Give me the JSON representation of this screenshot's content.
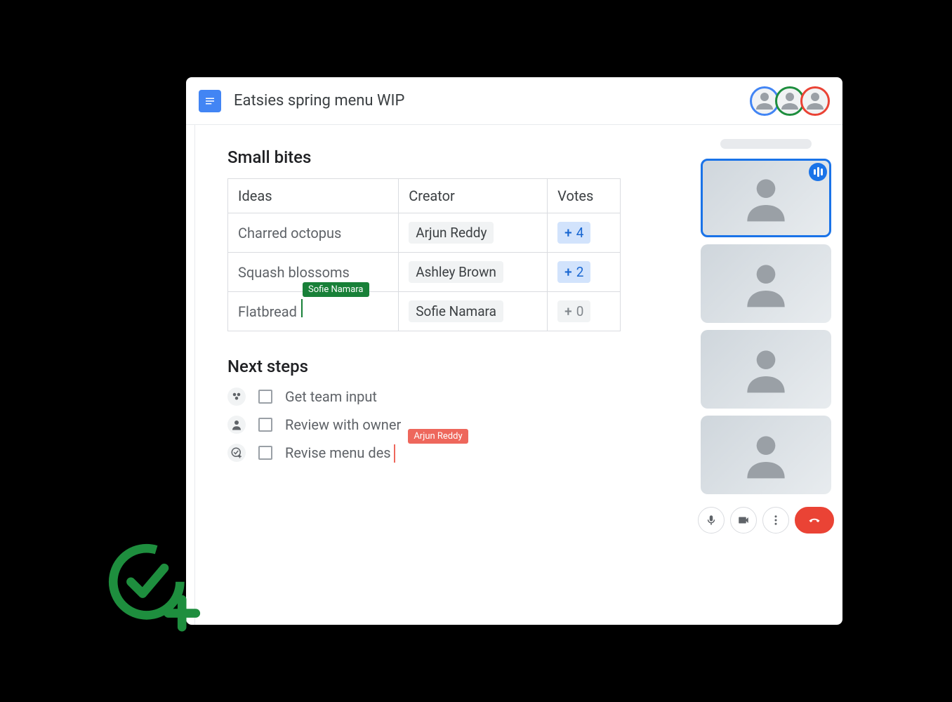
{
  "header": {
    "doc_title": "Eatsies spring menu WIP",
    "collaborators": [
      {
        "name": "Collaborator 1",
        "ring": "blue"
      },
      {
        "name": "Collaborator 2",
        "ring": "green"
      },
      {
        "name": "Collaborator 3",
        "ring": "red"
      }
    ]
  },
  "document": {
    "section_small_bites": "Small bites",
    "table": {
      "headers": {
        "ideas": "Ideas",
        "creator": "Creator",
        "votes": "Votes"
      },
      "rows": [
        {
          "idea": "Charred octopus",
          "creator": "Arjun Reddy",
          "votes": 4,
          "vote_style": "blue"
        },
        {
          "idea": "Squash blossoms",
          "creator": "Ashley Brown",
          "votes": 2,
          "vote_style": "blue"
        },
        {
          "idea": "Flatbread",
          "creator": "Sofie Namara",
          "votes": 0,
          "vote_style": "grey",
          "live_editor": "Sofie Namara"
        }
      ]
    },
    "section_next_steps": "Next steps",
    "tasks": [
      {
        "icon": "group",
        "text": "Get team input"
      },
      {
        "icon": "person",
        "text": "Review with owner"
      },
      {
        "icon": "add-task",
        "text": "Revise menu des",
        "live_editor": "Arjun Reddy"
      }
    ]
  },
  "meet": {
    "participants": [
      {
        "name": "Participant 1",
        "speaking": true
      },
      {
        "name": "Participant 2",
        "speaking": false
      },
      {
        "name": "Participant 3",
        "speaking": false
      },
      {
        "name": "Participant 4",
        "speaking": false
      }
    ],
    "controls": {
      "mic": "mic",
      "cam": "camera",
      "more": "more",
      "hangup": "hangup"
    }
  },
  "colors": {
    "accent_blue": "#1a73e8",
    "live_green": "#188038",
    "live_red": "#ee675c",
    "hangup": "#ea4335"
  }
}
